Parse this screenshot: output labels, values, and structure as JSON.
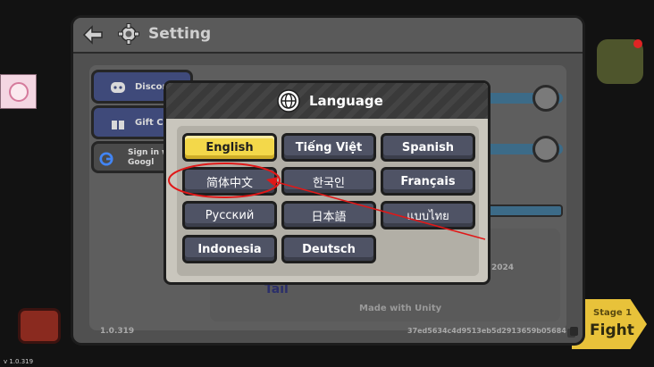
{
  "settings": {
    "title": "Setting",
    "discord_label": "Discord",
    "gift_code_label": "Gift Co",
    "google_label_line1": "Sign in w",
    "google_label_line2": "Googl",
    "build_version": "1.0.319",
    "device_id": "37ed5634c4d9513eb5d2913659b05684",
    "credits_year": "2024",
    "made_with": "Made with Unity",
    "tail_logo": "Tail"
  },
  "language_dialog": {
    "title": "Language",
    "options": [
      {
        "label": "English",
        "selected": true
      },
      {
        "label": "Tiếng Việt",
        "selected": false
      },
      {
        "label": "Spanish",
        "selected": false
      },
      {
        "label": "简体中文",
        "selected": false
      },
      {
        "label": "한국인",
        "selected": false
      },
      {
        "label": "Français",
        "selected": false
      },
      {
        "label": "Русский",
        "selected": false
      },
      {
        "label": "日本語",
        "selected": false
      },
      {
        "label": "แบบไทย",
        "selected": false
      },
      {
        "label": "Indonesia",
        "selected": false
      },
      {
        "label": "Deutsch",
        "selected": false
      }
    ]
  },
  "hud": {
    "app_version": "v 1.0.319",
    "stage_label": "Stage 1",
    "fight_label": "Fight"
  },
  "colors": {
    "selected_button": "#f3d84a",
    "language_button": "#4f5365",
    "annotation": "#e01818",
    "slider": "#3c6b88"
  }
}
